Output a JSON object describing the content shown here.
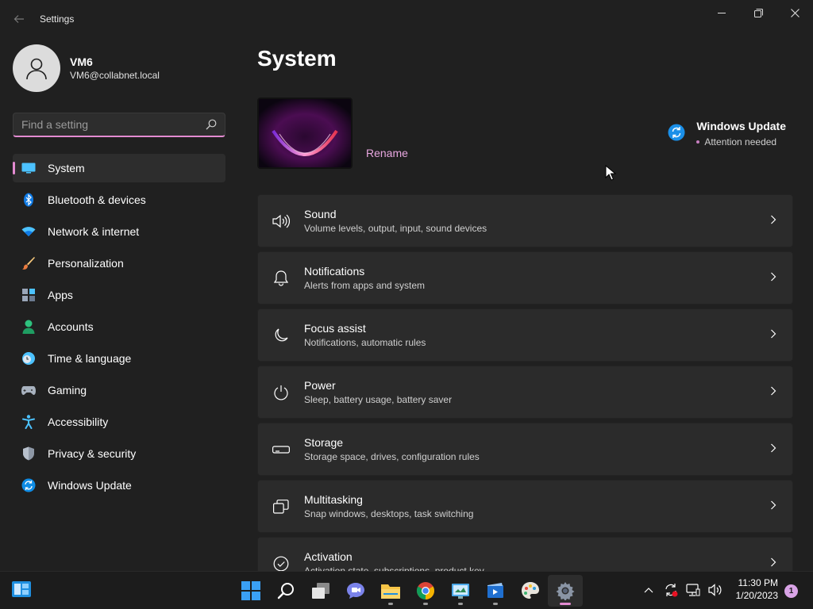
{
  "window": {
    "title": "Settings"
  },
  "profile": {
    "name": "VM6",
    "email": "VM6@collabnet.local"
  },
  "search": {
    "placeholder": "Find a setting"
  },
  "sidebar": {
    "items": [
      {
        "label": "System",
        "icon": "monitor-icon",
        "active": true
      },
      {
        "label": "Bluetooth & devices",
        "icon": "bluetooth-icon"
      },
      {
        "label": "Network & internet",
        "icon": "wifi-icon"
      },
      {
        "label": "Personalization",
        "icon": "brush-icon"
      },
      {
        "label": "Apps",
        "icon": "apps-icon"
      },
      {
        "label": "Accounts",
        "icon": "person-icon"
      },
      {
        "label": "Time & language",
        "icon": "clock-globe-icon"
      },
      {
        "label": "Gaming",
        "icon": "gamepad-icon"
      },
      {
        "label": "Accessibility",
        "icon": "accessibility-icon"
      },
      {
        "label": "Privacy & security",
        "icon": "shield-icon"
      },
      {
        "label": "Windows Update",
        "icon": "update-icon"
      }
    ]
  },
  "main": {
    "title": "System",
    "rename_label": "Rename",
    "windows_update": {
      "title": "Windows Update",
      "status": "Attention needed"
    },
    "cards": [
      {
        "title": "Sound",
        "subtitle": "Volume levels, output, input, sound devices",
        "icon": "speaker-icon"
      },
      {
        "title": "Notifications",
        "subtitle": "Alerts from apps and system",
        "icon": "bell-icon"
      },
      {
        "title": "Focus assist",
        "subtitle": "Notifications, automatic rules",
        "icon": "moon-icon"
      },
      {
        "title": "Power",
        "subtitle": "Sleep, battery usage, battery saver",
        "icon": "power-icon"
      },
      {
        "title": "Storage",
        "subtitle": "Storage space, drives, configuration rules",
        "icon": "drive-icon"
      },
      {
        "title": "Multitasking",
        "subtitle": "Snap windows, desktops, task switching",
        "icon": "multitask-icon"
      },
      {
        "title": "Activation",
        "subtitle": "Activation state, subscriptions, product key",
        "icon": "check-circle-icon"
      }
    ]
  },
  "taskbar": {
    "apps": [
      "start-icon",
      "search-icon",
      "task-view-icon",
      "chat-icon",
      "file-explorer-icon",
      "chrome-icon",
      "control-panel-icon",
      "movie-maker-icon",
      "paint-icon",
      "settings-icon"
    ],
    "clock": {
      "time": "11:30 PM",
      "date": "1/20/2023"
    },
    "notification_count": "1"
  },
  "colors": {
    "accent": "#e38bd1",
    "background": "#202020",
    "card": "#2b2b2b",
    "taskbar": "#1c1c1c"
  }
}
